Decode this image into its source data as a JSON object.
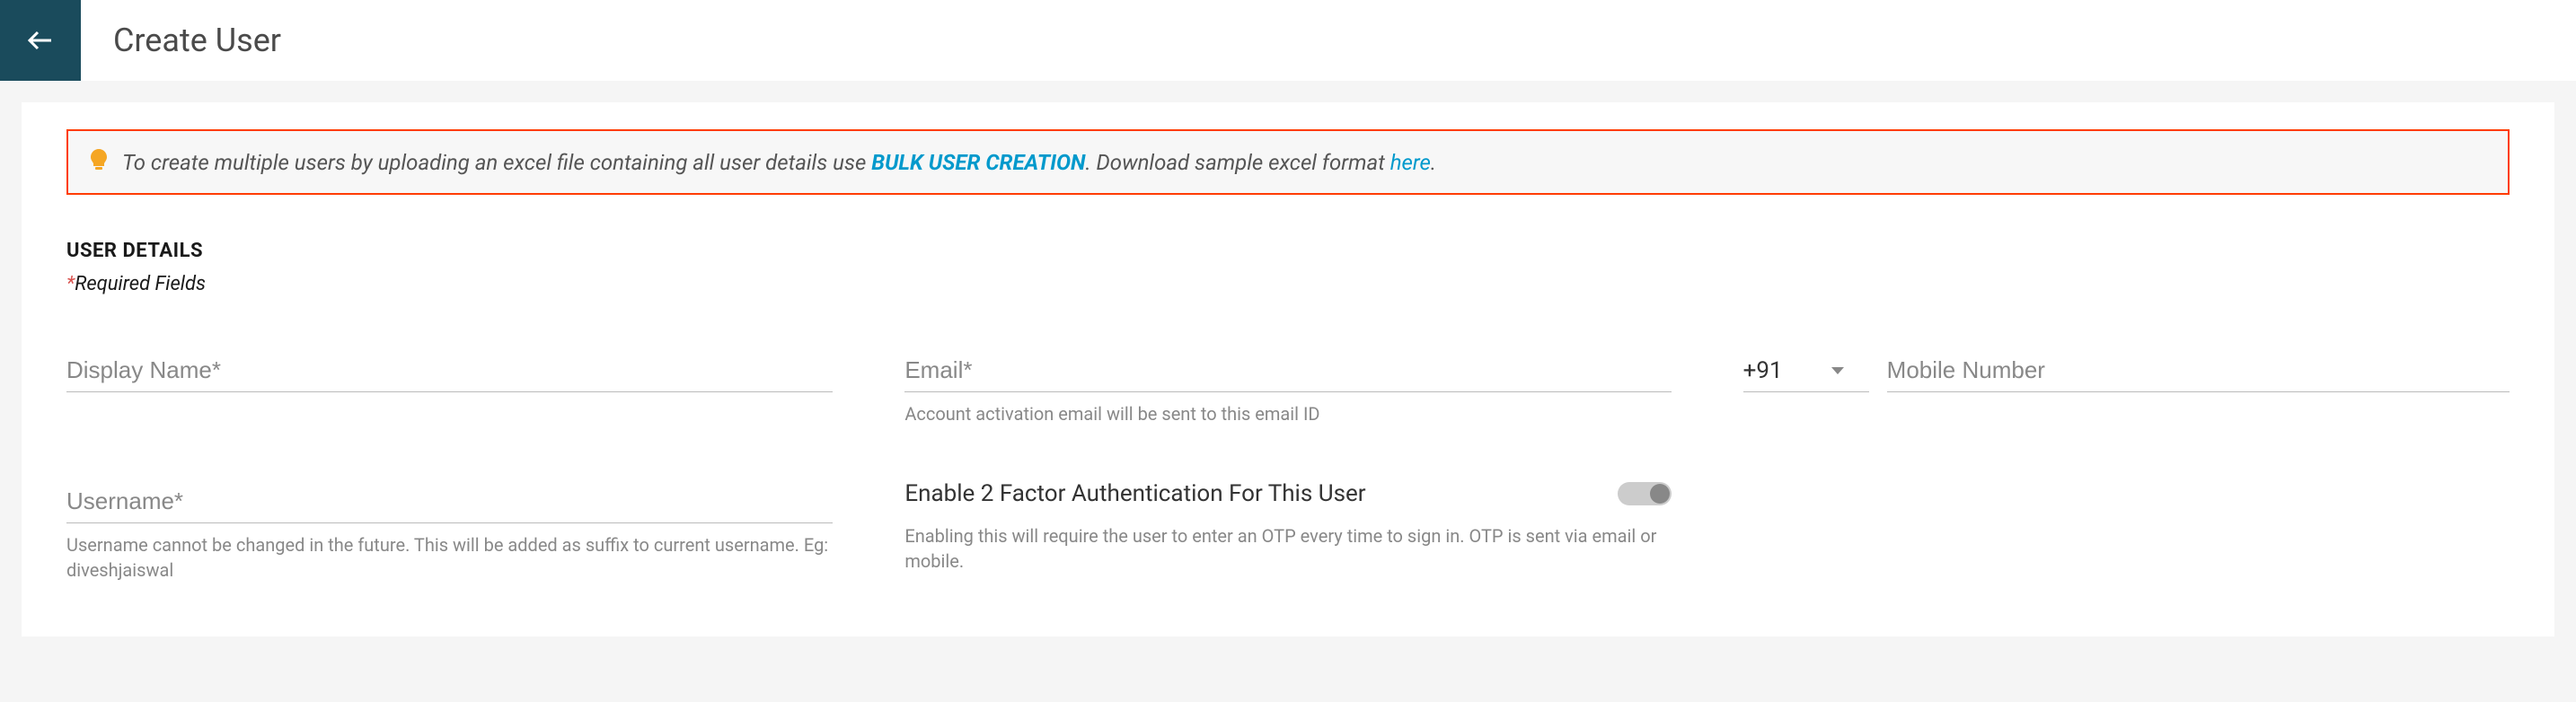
{
  "header": {
    "title": "Create User"
  },
  "banner": {
    "text_before": "To create multiple users by uploading an excel file containing all user details use ",
    "bulk_link": "BULK USER CREATION",
    "text_after_bulk": ". Download sample excel format ",
    "here_link": "here",
    "text_end": "."
  },
  "section": {
    "heading": "USER DETAILS",
    "required_note": "Required Fields"
  },
  "fields": {
    "display_name": {
      "placeholder": "Display Name*",
      "value": ""
    },
    "email": {
      "placeholder": "Email*",
      "value": "",
      "helper": "Account activation email will be sent to this email ID"
    },
    "country_code": {
      "value": "+91"
    },
    "mobile": {
      "placeholder": "Mobile Number",
      "value": ""
    },
    "username": {
      "placeholder": "Username*",
      "value": "",
      "helper": "Username cannot be changed in the future. This will be added as suffix to current username. Eg: diveshjaiswal"
    },
    "two_factor": {
      "label": "Enable 2 Factor Authentication For This User",
      "helper": "Enabling this will require the user to enter an OTP every time to sign in. OTP is sent via email or mobile."
    }
  }
}
